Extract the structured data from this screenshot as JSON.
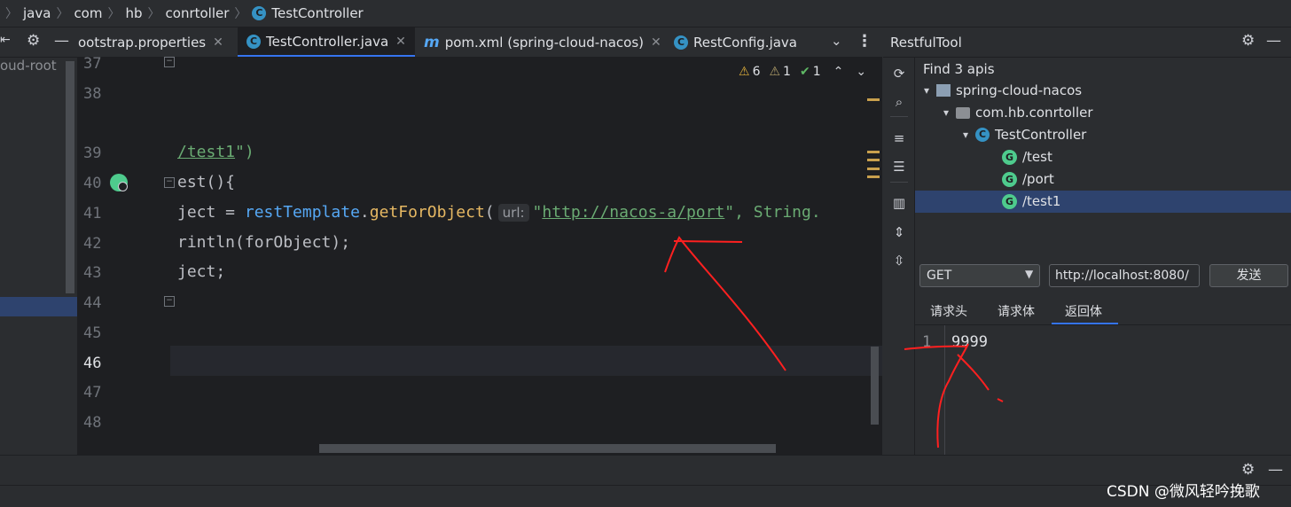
{
  "breadcrumb": [
    "java",
    "com",
    "hb",
    "conrtoller",
    "TestController"
  ],
  "tabs": [
    {
      "label": "ootstrap.properties",
      "icon": "properties-icon"
    },
    {
      "label": "TestController.java",
      "icon": "class-icon"
    },
    {
      "label": "pom.xml (spring-cloud-nacos)",
      "icon": "maven-icon"
    },
    {
      "label": "RestConfig.java",
      "icon": "class-icon"
    }
  ],
  "project": {
    "root_label": "oud-root"
  },
  "editor": {
    "line_numbers": [
      "37",
      "38",
      "39",
      "40",
      "41",
      "42",
      "43",
      "44",
      "45",
      "46",
      "47",
      "48"
    ],
    "inspections": {
      "warnings": "6",
      "weak_warnings": "1",
      "typos": "1"
    },
    "code": {
      "l39_path": "/test1",
      "l39_end": "\")",
      "l40": "est(){",
      "l41_a": "ject = ",
      "l41_b": "restTemplate",
      "l41_c": ".",
      "l41_d": "getForObject",
      "l41_e": "(",
      "l41_hint": "url:",
      "l41_q": "\"",
      "l41_url": "http://nacos-a/port",
      "l41_end": "\", String.",
      "l42": "rintln(forObject);",
      "l43": "ject;"
    }
  },
  "restful": {
    "title": "RestfulTool",
    "find_label": "Find 3 apis",
    "tree": {
      "project": "spring-cloud-nacos",
      "package": "com.hb.conrtoller",
      "class": "TestController",
      "apis": [
        "/test",
        "/port",
        "/test1"
      ]
    },
    "method": "GET",
    "url": "http://localhost:8080/",
    "send_label": "发送",
    "tabs": [
      "请求头",
      "请求体",
      "返回体"
    ],
    "response": {
      "line": "1",
      "body": "9999"
    }
  },
  "watermark": "CSDN @微风轻吟挽歌",
  "colors": {
    "accent": "#3574f0",
    "selection": "#2e436e",
    "string": "#6aab73",
    "method": "#56a8f5"
  }
}
